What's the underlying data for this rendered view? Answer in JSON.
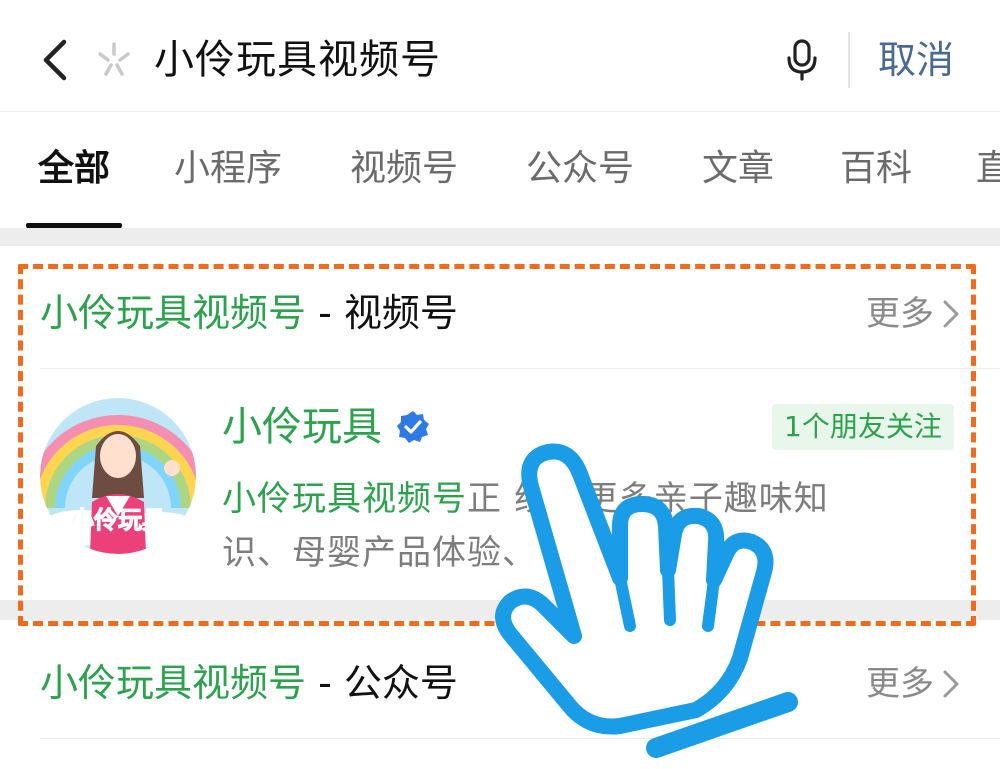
{
  "search": {
    "query": "小伶玩具视频号",
    "cancel_label": "取消"
  },
  "tabs": [
    "全部",
    "小程序",
    "视频号",
    "公众号",
    "文章",
    "百科",
    "直"
  ],
  "sections": [
    {
      "keyword": "小伶玩具视频号",
      "suffix": " - 视频号",
      "more_label": "更多",
      "account": {
        "name": "小伶玩具",
        "friends_badge": "1个朋友关注",
        "desc_keyword": "小伶玩具视频号",
        "desc_line1_rest": "正    线，更多亲子趣味知",
        "desc_line2": "识、母婴产品体验、       答，您都能...",
        "avatar_text": "小伶玩具"
      }
    },
    {
      "keyword": "小伶玩具视频号",
      "suffix": " - 公众号",
      "more_label": "更多"
    }
  ],
  "colors": {
    "keyword_green": "#2ba24c",
    "cancel_blue": "#4a6a94",
    "frame_orange": "#f26a1b",
    "hand_blue": "#1b9ce6"
  },
  "icons": [
    "back-icon",
    "spark-icon",
    "mic-icon",
    "chevron-right-icon",
    "verified-icon",
    "hand-pointer-icon"
  ]
}
